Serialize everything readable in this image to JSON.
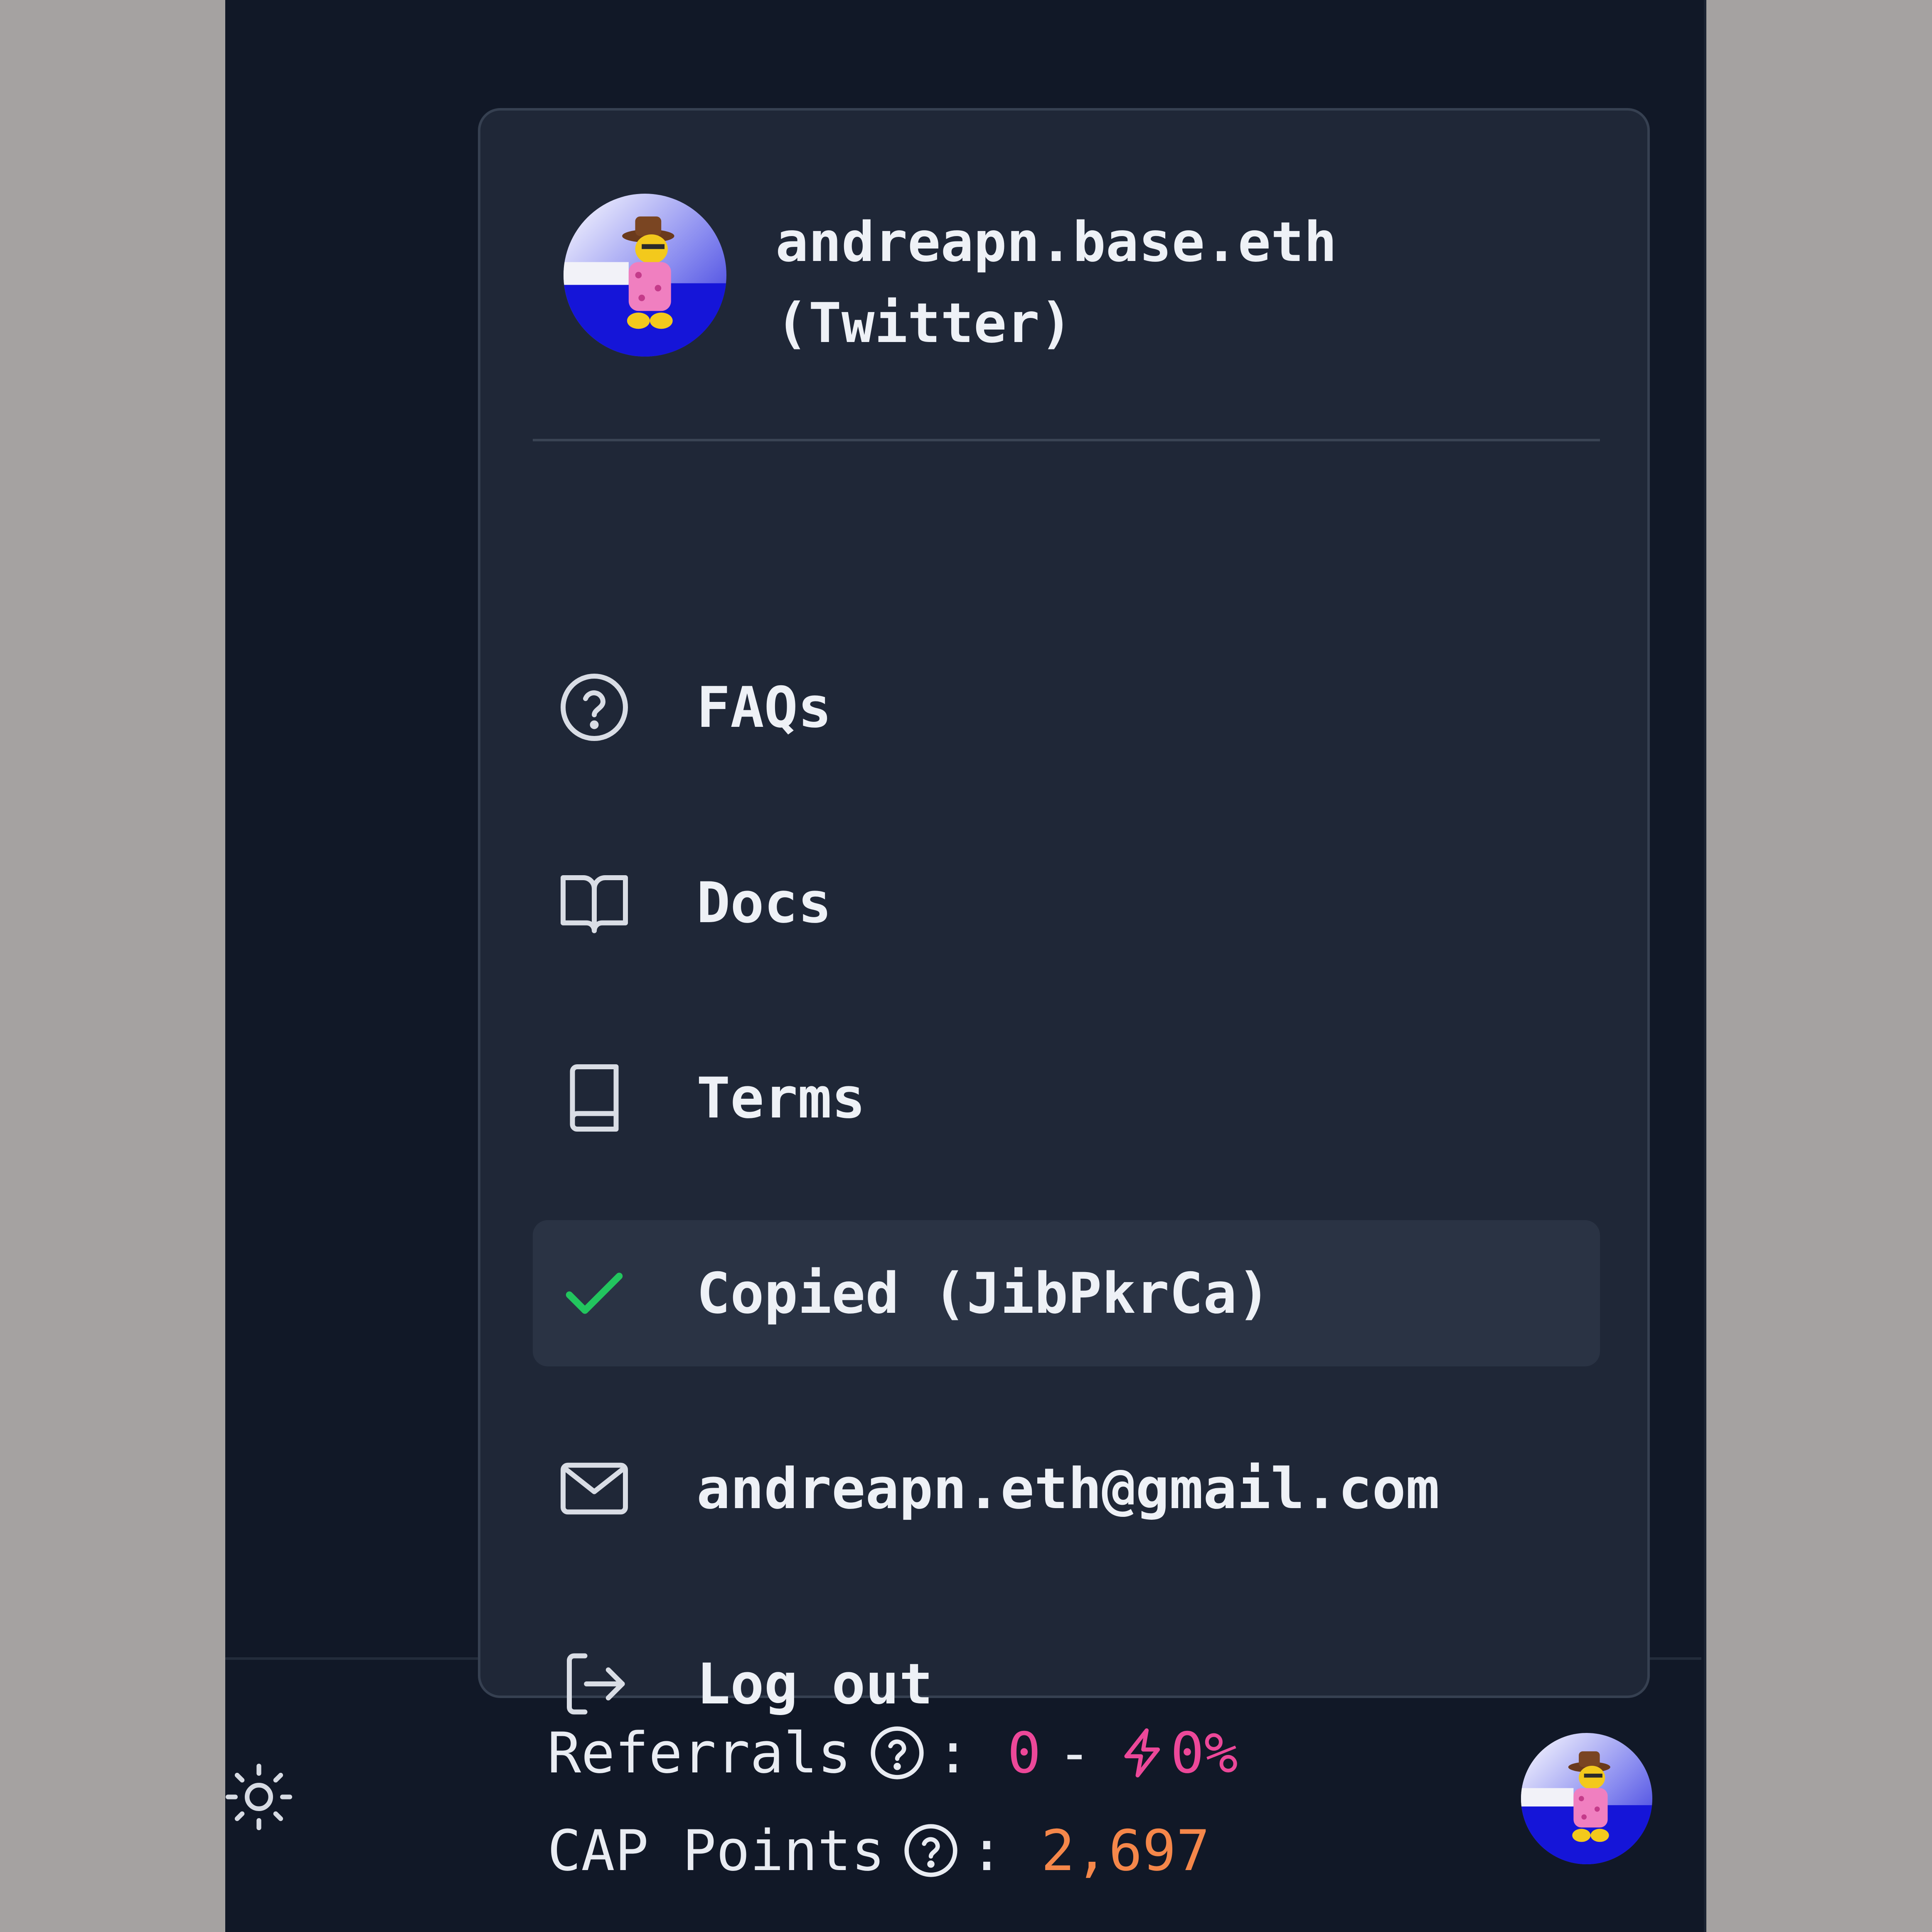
{
  "user": {
    "display_name": "andreapn.base.eth (Twitter)",
    "avatar_icon": "cartoon-character-avatar"
  },
  "menu": {
    "items": [
      {
        "label": "FAQs",
        "icon": "help-circle-icon"
      },
      {
        "label": "Docs",
        "icon": "open-book-icon"
      },
      {
        "label": "Terms",
        "icon": "book-icon"
      },
      {
        "label": "Copied (JibPkrCa)",
        "icon": "check-icon",
        "active": true
      },
      {
        "label": "andreapn.eth@gmail.com",
        "icon": "mail-icon"
      },
      {
        "label": "Log out",
        "icon": "logout-icon"
      }
    ]
  },
  "footer": {
    "referrals_label": "Referrals",
    "referrals_count": "0",
    "referrals_separator": "-",
    "referrals_boost": "0%",
    "cap_label": "CAP Points",
    "cap_value": "2,697",
    "colon": ":"
  },
  "colors": {
    "background": "#111827",
    "menu_bg": "#1f2737",
    "active_item_bg": "#2a3344",
    "check_green": "#22c55e",
    "referral_pink": "#ec4899",
    "cap_orange": "#f5874a"
  }
}
